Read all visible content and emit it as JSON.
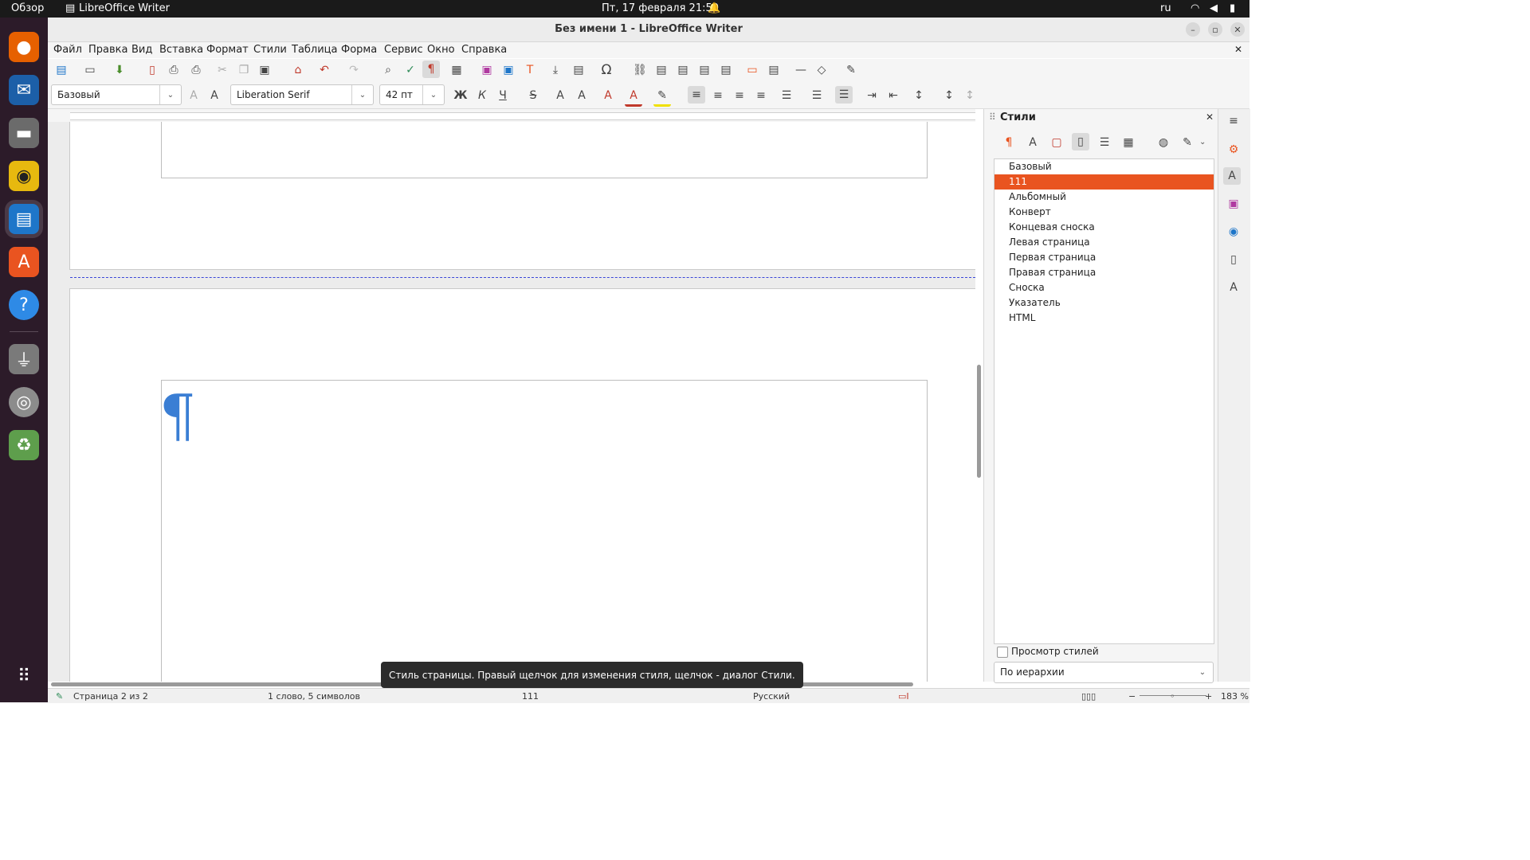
{
  "topbar": {
    "activities": "Обзор",
    "app": "LibreOffice Writer",
    "clock": "Пт, 17 февраля  21:50",
    "lang": "ru"
  },
  "window": {
    "title": "Без имени 1 - LibreOffice Writer"
  },
  "menu": [
    "Файл",
    "Правка",
    "Вид",
    "Вставка",
    "Формат",
    "Стили",
    "Таблица",
    "Форма",
    "Сервис",
    "Окно",
    "Справка"
  ],
  "formatting": {
    "paragraph_style": "Базовый",
    "font_name": "Liberation Serif",
    "font_size": "42 пт"
  },
  "document": {
    "pilcrow": "¶"
  },
  "sidebar": {
    "title": "Стили",
    "styles": [
      "Базовый",
      "111",
      "Альбомный",
      "Конверт",
      "Концевая сноска",
      "Левая страница",
      "Первая страница",
      "Правая страница",
      "Сноска",
      "Указатель",
      "HTML"
    ],
    "selected_index": 1,
    "preview_label": "Просмотр стилей",
    "filter_value": "По иерархии"
  },
  "tooltip": "Стиль страницы. Правый щелчок для изменения стиля, щелчок - диалог Стили.",
  "status": {
    "page": "Страница 2 из 2",
    "words": "1 слово, 5 символов",
    "page_style": "111",
    "language": "Русский",
    "zoom": "183 %"
  },
  "colors": {
    "accent": "#e95420",
    "pilcrow": "#3a7ed4",
    "dock": "#2c1b29"
  }
}
